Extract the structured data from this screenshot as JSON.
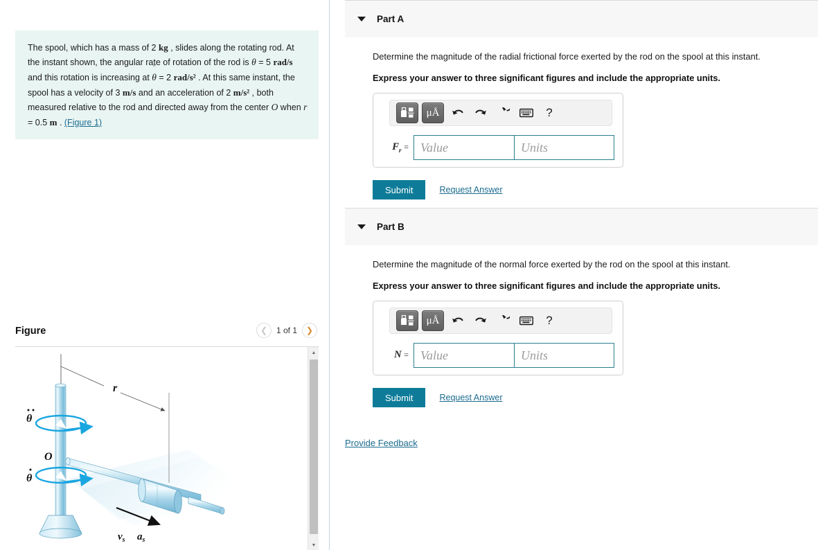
{
  "colors": {
    "accent_teal": "#0e7c99",
    "link_blue": "#1b6b8e",
    "problem_bg": "#e9f5f3",
    "part_header_bg": "#f7f7f7",
    "input_border": "#2b7d8f",
    "figure_blue": "#a9d8ec",
    "next_arrow": "#d98b34"
  },
  "problem": {
    "segments": [
      {
        "t": "The spool, which has a mass of 2 ",
        "k": "plain"
      },
      {
        "t": "kg",
        "k": "unit"
      },
      {
        "t": " , slides along the rotating rod. At the instant shown, the angular rate of rotation of the rod is ",
        "k": "plain"
      },
      {
        "t": "θ",
        "k": "dot1"
      },
      {
        "t": " = 5 ",
        "k": "plain"
      },
      {
        "t": "rad/s",
        "k": "unit"
      },
      {
        "t": " and this rotation is increasing at ",
        "k": "plain"
      },
      {
        "t": "θ",
        "k": "dot2"
      },
      {
        "t": " = 2 ",
        "k": "plain"
      },
      {
        "t": "rad/s²",
        "k": "unit"
      },
      {
        "t": " . At this same instant, the spool has a velocity of 3 ",
        "k": "plain"
      },
      {
        "t": "m/s",
        "k": "unit"
      },
      {
        "t": " and an acceleration of 2 ",
        "k": "plain"
      },
      {
        "t": "m/s²",
        "k": "unit"
      },
      {
        "t": " , both measured relative to the rod and directed away from the center ",
        "k": "plain"
      },
      {
        "t": "O",
        "k": "var"
      },
      {
        "t": " when ",
        "k": "plain"
      },
      {
        "t": "r",
        "k": "var"
      },
      {
        "t": " = 0.5 ",
        "k": "plain"
      },
      {
        "t": "m",
        "k": "unit"
      },
      {
        "t": " . ",
        "k": "plain"
      },
      {
        "t": "(Figure 1)",
        "k": "figlink"
      }
    ],
    "mass": "2 kg",
    "theta_dot": "5 rad/s",
    "theta_ddot": "2 rad/s^2",
    "velocity": "3 m/s",
    "acceleration": "2 m/s^2",
    "radius": "0.5 m",
    "figure_link": "(Figure 1)"
  },
  "figure": {
    "title": "Figure",
    "counter": "1 of 1",
    "prev_icon": "chevron-left-icon",
    "next_icon": "chevron-right-icon",
    "scroll_up_icon": "triangle-up-icon",
    "scroll_down_icon": "triangle-down-icon",
    "labels": {
      "center": "O",
      "radius": "r",
      "theta_dot": "θ",
      "theta_ddot": "θ",
      "velocity": "v",
      "velocity_sub": "s",
      "accel": "a",
      "accel_sub": "s"
    }
  },
  "toolbar": {
    "template_icon": "math-template-icon",
    "units_icon": "units-micro-angstrom-icon",
    "units_label": "μÅ",
    "undo_icon": "undo-arrow-icon",
    "redo_icon": "redo-arrow-icon",
    "reset_icon": "reset-circular-arrow-icon",
    "keyboard_icon": "keyboard-icon",
    "help_icon": "question-mark-icon",
    "help_label": "?"
  },
  "parts": [
    {
      "id": "part-a",
      "label": "Part A",
      "question": "Determine the magnitude of the radial frictional force exerted by the rod on the spool at this instant.",
      "instruction": "Express your answer to three significant figures and include the appropriate units.",
      "symbol": "F",
      "symbol_sub": "r",
      "equals": "=",
      "value_placeholder": "Value",
      "units_placeholder": "Units",
      "value": "",
      "units": "",
      "submit_label": "Submit",
      "request_answer_label": "Request Answer"
    },
    {
      "id": "part-b",
      "label": "Part B",
      "question": "Determine the magnitude of the normal force exerted by the rod on the spool at this instant.",
      "instruction": "Express your answer to three significant figures and include the appropriate units.",
      "symbol": "N",
      "symbol_sub": "",
      "equals": "=",
      "value_placeholder": "Value",
      "units_placeholder": "Units",
      "value": "",
      "units": "",
      "submit_label": "Submit",
      "request_answer_label": "Request Answer"
    }
  ],
  "footer": {
    "feedback_label": "Provide Feedback"
  }
}
